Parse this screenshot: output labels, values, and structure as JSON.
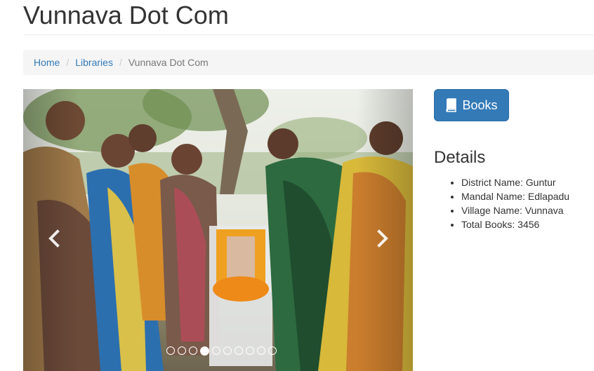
{
  "header": {
    "title": "Vunnava Dot Com"
  },
  "breadcrumb": {
    "items": [
      {
        "label": "Home"
      },
      {
        "label": "Libraries"
      }
    ],
    "separator": "/",
    "active": "Vunnava Dot Com"
  },
  "carousel": {
    "indicator_count": 10,
    "active_index": 3,
    "prev_icon": "chevron-left-icon",
    "next_icon": "chevron-right-icon"
  },
  "sidebar": {
    "books_button": {
      "label": "Books",
      "icon": "book-icon"
    },
    "details": {
      "title": "Details",
      "items": [
        "District Name: Guntur",
        "Mandal Name: Edlapadu",
        "Village Name: Vunnava",
        "Total Books: 3456"
      ]
    }
  },
  "colors": {
    "primary": "#337ab7",
    "link": "#337ab7",
    "breadcrumb_bg": "#f5f5f5",
    "text": "#333333"
  }
}
